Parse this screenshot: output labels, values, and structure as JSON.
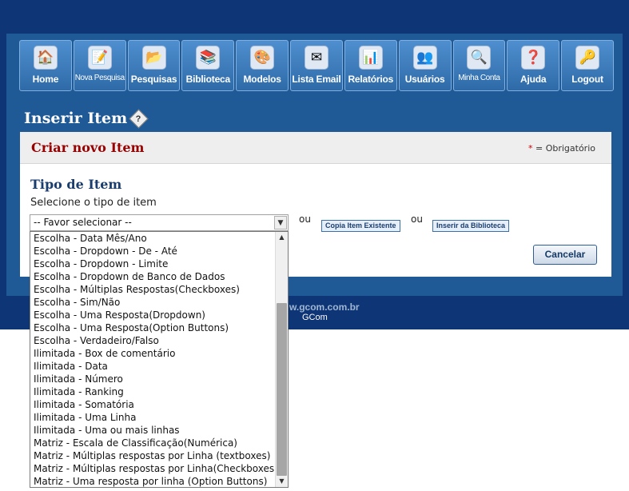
{
  "nav": [
    {
      "label": "Home",
      "icon": "home-icon",
      "glyph": "🏠",
      "small": false
    },
    {
      "label": "Nova Pesquisa",
      "icon": "new-survey-icon",
      "glyph": "📝",
      "small": true
    },
    {
      "label": "Pesquisas",
      "icon": "folder-icon",
      "glyph": "📂",
      "small": false
    },
    {
      "label": "Biblioteca",
      "icon": "library-icon",
      "glyph": "📚",
      "small": false
    },
    {
      "label": "Modelos",
      "icon": "palette-icon",
      "glyph": "🎨",
      "small": false
    },
    {
      "label": "Lista Email",
      "icon": "email-list-icon",
      "glyph": "✉",
      "small": false
    },
    {
      "label": "Relatórios",
      "icon": "reports-icon",
      "glyph": "📊",
      "small": false
    },
    {
      "label": "Usuários",
      "icon": "users-icon",
      "glyph": "👥",
      "small": false
    },
    {
      "label": "Minha Conta",
      "icon": "my-account-icon",
      "glyph": "🔍",
      "small": true
    },
    {
      "label": "Ajuda",
      "icon": "help-icon",
      "glyph": "❓",
      "small": false
    },
    {
      "label": "Logout",
      "icon": "key-icon",
      "glyph": "🔑",
      "small": false
    }
  ],
  "page": {
    "title": "Inserir Item",
    "help_glyph": "?"
  },
  "panel": {
    "title": "Criar novo Item",
    "required_star": "*",
    "required_text": "= Obrigatório",
    "section_title": "Tipo de Item",
    "instruction": "Selecione o tipo de item",
    "select_value": "-- Favor selecionar --",
    "or_1": "ou",
    "copy_button": "Copia Item Existente",
    "or_2": "ou",
    "library_button": "Inserir da Biblioteca",
    "cancel_button": "Cancelar"
  },
  "footer": {
    "site": "w.gcom.com.br",
    "brand": "GCom"
  },
  "dropdown_options": [
    "Escolha - Data Mês/Ano",
    "Escolha - Dropdown - De - Até",
    "Escolha - Dropdown - Limite",
    "Escolha - Dropdown de Banco de Dados",
    "Escolha - Múltiplas Respostas(Checkboxes)",
    "Escolha - Sim/Não",
    "Escolha - Uma Resposta(Dropdown)",
    "Escolha - Uma Resposta(Option Buttons)",
    "Escolha - Verdadeiro/Falso",
    "Ilimitada - Box de comentário",
    "Ilimitada - Data",
    "Ilimitada - Número",
    "Ilimitada - Ranking",
    "Ilimitada - Somatória",
    "Ilimitada - Uma Linha",
    "Ilimitada - Uma ou mais linhas",
    "Matriz - Escala de Classificação(Numérica)",
    "Matriz - Múltiplas respostas por Linha (textboxes)",
    "Matriz - Múltiplas respostas por Linha(Checkboxes)",
    "Matriz - Uma resposta por linha (Option Buttons)"
  ],
  "colors": {
    "background_dark": "#0e3575",
    "frame": "#1f5a96",
    "panel_title": "#990000",
    "section_title": "#1b3d6d"
  }
}
